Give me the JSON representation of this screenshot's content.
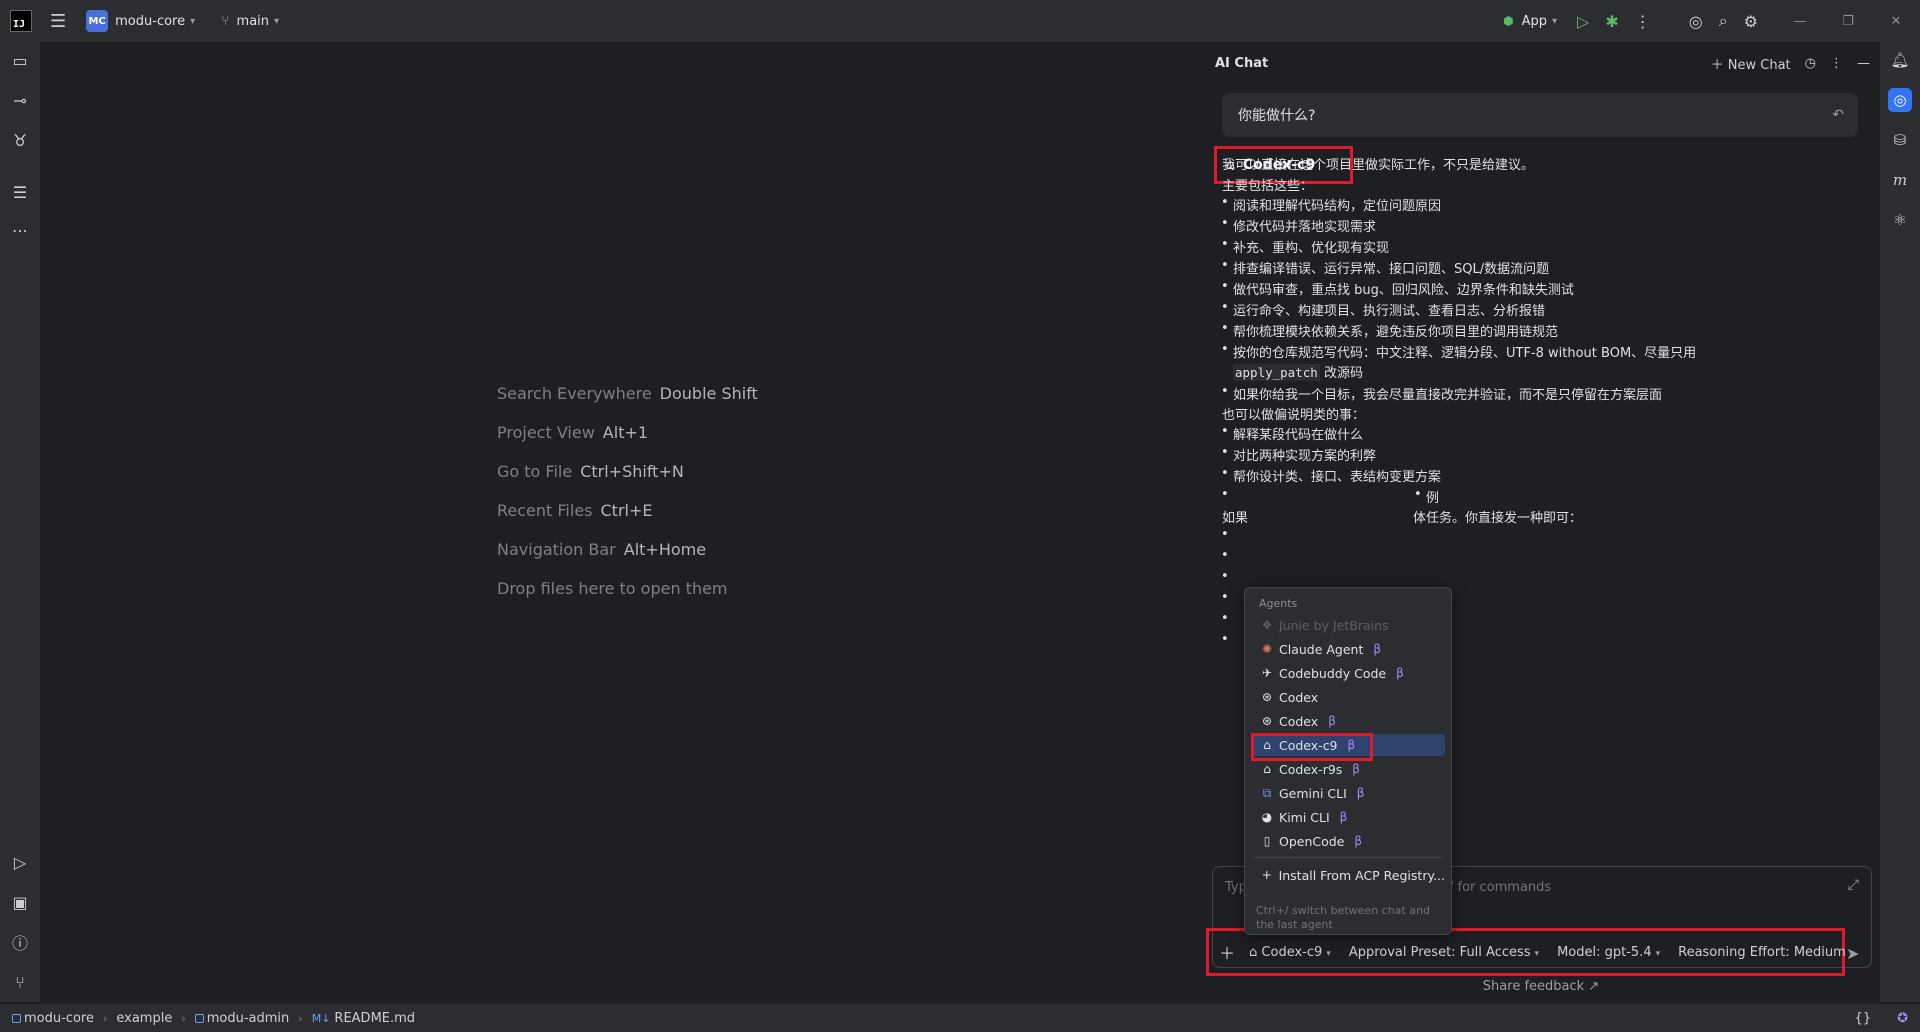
{
  "titlebar": {
    "ide_logo": "IJ",
    "project_badge": "MC",
    "project_name": "modu-core",
    "branch": "main",
    "run_config": "App"
  },
  "editor": {
    "hints": [
      {
        "action": "Search Everywhere",
        "key": "Double Shift"
      },
      {
        "action": "Project View",
        "key": "Alt+1"
      },
      {
        "action": "Go to File",
        "key": "Ctrl+Shift+N"
      },
      {
        "action": "Recent Files",
        "key": "Ctrl+E"
      },
      {
        "action": "Navigation Bar",
        "key": "Alt+Home"
      },
      {
        "action": "Drop files here to open them",
        "key": ""
      }
    ]
  },
  "chat": {
    "title": "AI Chat",
    "new_chat_label": "New Chat",
    "question": "你能做什么?",
    "agent_name": "Codex-c9",
    "intro": "我可以直接在这个项目里做实际工作，不只是给建议。",
    "section1_title": "主要包括这些：",
    "bullets1": [
      "阅读和理解代码结构，定位问题原因",
      "修改代码并落地实现需求",
      "补充、重构、优化现有实现",
      "排查编译错误、运行异常、接口问题、SQL/数据流问题",
      "做代码审查，重点找 bug、回归风险、边界条件和缺失测试",
      "运行命令、构建项目、执行测试、查看日志、分析报错",
      "帮你梳理模块依赖关系，避免违反你项目里的调用链规范",
      "按你的仓库规范写代码：中文注释、逻辑分段、UTF-8 without BOM、尽量只用"
    ],
    "code_token": "apply_patch",
    "code_suffix": "改源码",
    "bullet_last1": "如果你给我一个目标，我会尽量直接改完并验证，而不是只停留在方案层面",
    "section2_title": "也可以做偏说明类的事：",
    "bullets2": [
      "解释某段代码在做什么",
      "对比两种实现方案的利弊",
      "帮你设计类、接口、表结构变更方案",
      "例"
    ],
    "closing_prefix": "如果",
    "closing_suffix": "体任务。你直接发一种即可：",
    "input_placeholder": "Typ",
    "input_commands": "/ for commands",
    "toolbar": {
      "agent": "Codex-c9",
      "approval": "Approval Preset: Full Access",
      "model": "Model: gpt-5.4",
      "reasoning": "Reasoning Effort: Medium"
    },
    "share_feedback": "Share feedback ↗"
  },
  "dropdown": {
    "header": "Agents",
    "items": [
      {
        "label": "Junie by JetBrains",
        "icon": "junie-icon",
        "glyph": "❖",
        "beta": false,
        "disabled": true
      },
      {
        "label": "Claude Agent",
        "icon": "claude-icon",
        "glyph": "✺",
        "beta": true
      },
      {
        "label": "Codebuddy Code",
        "icon": "codebuddy-icon",
        "glyph": "✈",
        "beta": true
      },
      {
        "label": "Codex",
        "icon": "openai-icon",
        "glyph": "⊛",
        "beta": false
      },
      {
        "label": "Codex",
        "icon": "openai-icon",
        "glyph": "⊛",
        "beta": true
      },
      {
        "label": "Codex-c9",
        "icon": "robot-icon",
        "glyph": "⌂",
        "beta": true,
        "selected": true
      },
      {
        "label": "Codex-r9s",
        "icon": "robot-icon",
        "glyph": "⌂",
        "beta": true
      },
      {
        "label": "Gemini CLI",
        "icon": "gemini-icon",
        "glyph": "⧉",
        "beta": true
      },
      {
        "label": "Kimi CLI",
        "icon": "kimi-icon",
        "glyph": "◕",
        "beta": true
      },
      {
        "label": "OpenCode",
        "icon": "opencode-icon",
        "glyph": "▯",
        "beta": true
      }
    ],
    "beta_symbol": "β",
    "install": "Install From ACP Registry...",
    "footer": "Ctrl+/ switch between chat and the last agent"
  },
  "statusbar": {
    "crumbs": [
      "modu-core",
      "example",
      "modu-admin",
      "README.md"
    ],
    "md_badge": "M↓"
  },
  "colors": {
    "accent": "#3574f0",
    "highlight_border": "#e0192c",
    "beta": "#a78bfa",
    "selected_row": "#2e436e"
  }
}
